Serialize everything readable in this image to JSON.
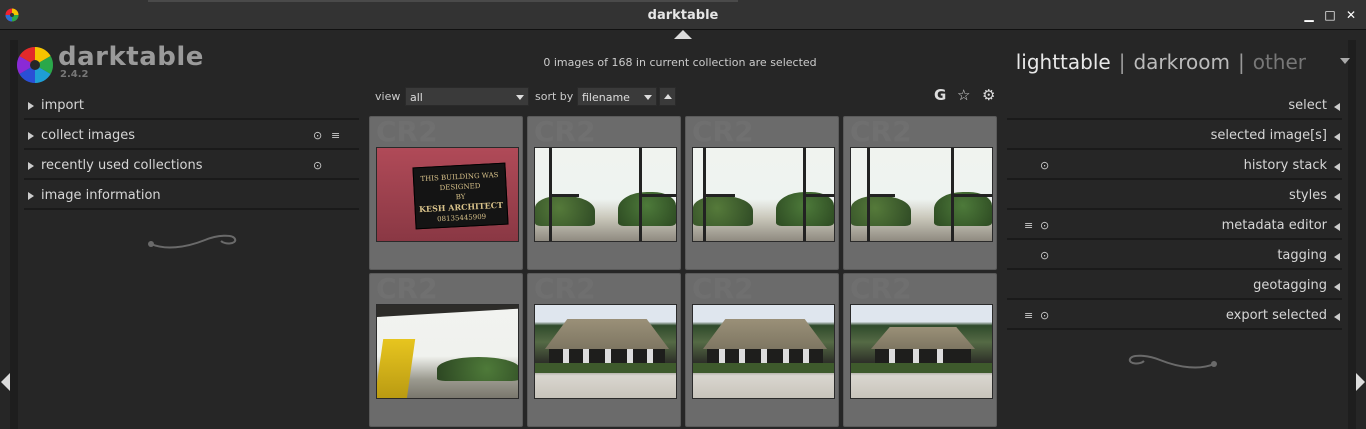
{
  "window": {
    "title": "darktable"
  },
  "app": {
    "name": "darktable",
    "version": "2.4.2"
  },
  "header": {
    "selection_info": "0 images of 168 in current collection are selected",
    "views": [
      "lighttable",
      "darkroom",
      "other"
    ],
    "separator": "|"
  },
  "left_modules": [
    {
      "label": "import"
    },
    {
      "label": "collect images",
      "icons": [
        "reset-icon",
        "presets-icon"
      ]
    },
    {
      "label": "recently used collections",
      "icons": [
        "reset-icon"
      ]
    },
    {
      "label": "image information"
    }
  ],
  "right_modules": [
    {
      "label": "select"
    },
    {
      "label": "selected image[s]"
    },
    {
      "label": "history stack",
      "icons": [
        "reset-icon"
      ]
    },
    {
      "label": "styles"
    },
    {
      "label": "metadata editor",
      "icons": [
        "presets-icon",
        "reset-icon"
      ]
    },
    {
      "label": "tagging",
      "icons": [
        "reset-icon"
      ]
    },
    {
      "label": "geotagging"
    },
    {
      "label": "export selected",
      "icons": [
        "presets-icon",
        "reset-icon"
      ]
    }
  ],
  "toolbar": {
    "view_label": "view",
    "view_value": "all",
    "sort_label": "sort by",
    "sort_value": "filename",
    "icons": [
      "grouping-icon",
      "star-icon",
      "preferences-icon"
    ],
    "grouping_glyph": "G"
  },
  "thumbnails": [
    {
      "format": "CR2",
      "subject": "sign",
      "sign_text": [
        "THIS BUILDING WAS",
        "DESIGNED",
        "BY",
        "KESH ARCHITECT",
        "08135445909"
      ]
    },
    {
      "format": "CR2",
      "subject": "porch"
    },
    {
      "format": "CR2",
      "subject": "porch"
    },
    {
      "format": "CR2",
      "subject": "porch"
    },
    {
      "format": "CR2",
      "subject": "chair"
    },
    {
      "format": "CR2",
      "subject": "roof"
    },
    {
      "format": "CR2",
      "subject": "roof"
    },
    {
      "format": "CR2",
      "subject": "roof"
    }
  ],
  "colors": {
    "background": "#262626",
    "panel": "#333333",
    "thumb_bg": "#6b6b6b"
  }
}
